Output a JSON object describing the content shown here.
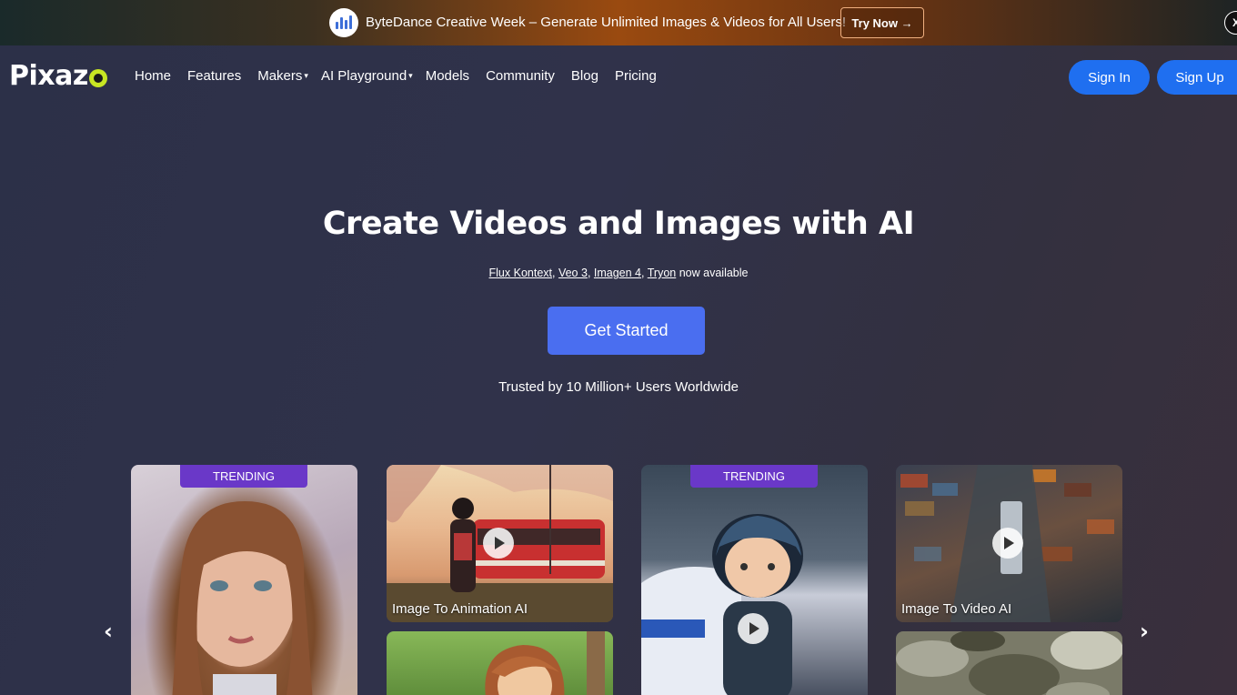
{
  "promo": {
    "text": "ByteDance Creative Week – Generate Unlimited Images & Videos for All Users!",
    "button": "Try Now →",
    "close": "X"
  },
  "nav": {
    "logo": "Pixaz",
    "items": [
      {
        "label": "Home"
      },
      {
        "label": "Features"
      },
      {
        "label": "Makers",
        "dropdown": true
      },
      {
        "label": "AI Playground",
        "dropdown": true
      },
      {
        "label": "Models"
      },
      {
        "label": "Community"
      },
      {
        "label": "Blog"
      },
      {
        "label": "Pricing"
      }
    ],
    "caret": "▾",
    "sign_in": "Sign In",
    "sign_up": "Sign Up"
  },
  "hero": {
    "title": "Create Videos and Images with AI",
    "links": [
      "Flux Kontext",
      "Veo 3",
      "Imagen 4",
      "Tryon"
    ],
    "suffix": "now available",
    "cta": "Get Started",
    "trusted": "Trusted by 10 Million+ Users Worldwide"
  },
  "cards": {
    "trending": "TRENDING",
    "anim_label": "Image To Animation AI",
    "video_label": "Image To Video AI"
  },
  "carousel": {
    "prev": "‹",
    "next": "›"
  },
  "colors": {
    "accent": "#1f6ff0",
    "cta": "#4a6ef0",
    "badge": "#6a38c8"
  }
}
